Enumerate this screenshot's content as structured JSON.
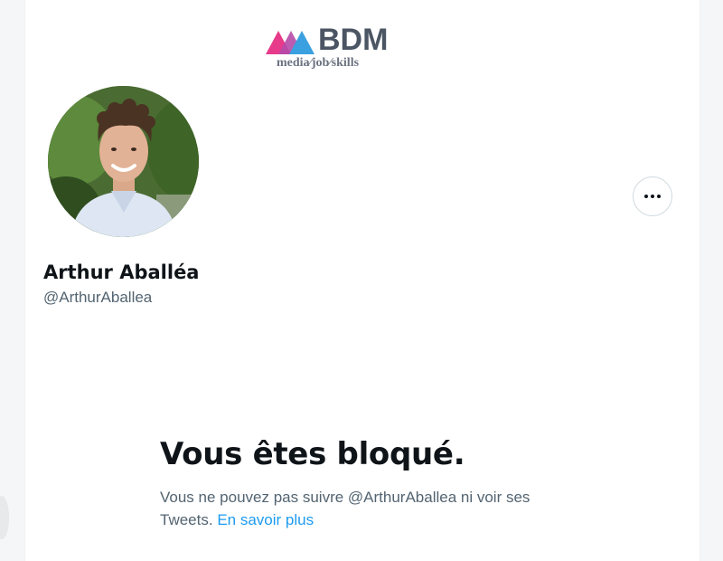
{
  "watermark": {
    "brand": "BDM",
    "tagline": "media∕job∕skills",
    "colors": {
      "pink": "#e73a8a",
      "blue": "#3aa0e0",
      "text": "#4b5563"
    }
  },
  "profile": {
    "display_name": "Arthur Aballéa",
    "handle": "@ArthurAballea",
    "avatar_icon": "profile-photo",
    "more_icon": "more-horizontal-icon"
  },
  "blocked": {
    "title": "Vous êtes bloqué.",
    "message": "Vous ne pouvez pas suivre @ArthurAballea ni voir ses Tweets.",
    "link_label": "En savoir plus"
  },
  "colors": {
    "primary_text": "#0f1419",
    "secondary_text": "#536471",
    "link": "#1d9bf0",
    "border": "#cfd9de"
  }
}
